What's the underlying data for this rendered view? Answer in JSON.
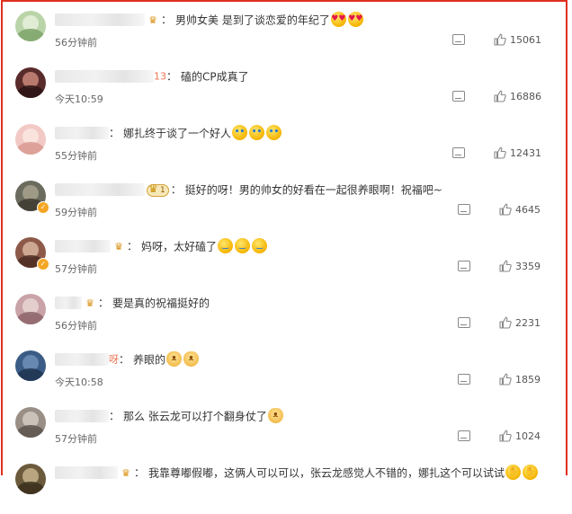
{
  "comments": [
    {
      "username_suffix": "",
      "badge": "crown",
      "text": "男帅女美 是到了谈恋爱的年纪了",
      "emojis": [
        {
          "name": "heart-eyes-emoji"
        },
        {
          "name": "heart-eyes-emoji"
        }
      ],
      "time": "56分钟前",
      "likes": "15061",
      "avatar_colors": [
        "#b9d4a8",
        "#e8f0dc",
        "#7da36a"
      ],
      "verified": false
    },
    {
      "username_suffix": "13",
      "badge": "",
      "text": "磕的CP成真了",
      "emojis": [],
      "time": "今天10:59",
      "likes": "16886",
      "avatar_colors": [
        "#5a2b2b",
        "#c9877a",
        "#2a1414"
      ],
      "verified": false
    },
    {
      "username_suffix": "",
      "badge": "",
      "text": "娜扎终于谈了一个好人",
      "emojis": [
        {
          "name": "crying-emoji"
        },
        {
          "name": "crying-emoji"
        },
        {
          "name": "crying-emoji"
        }
      ],
      "time": "55分钟前",
      "likes": "12431",
      "avatar_colors": [
        "#f2c9c4",
        "#fbe7e2",
        "#d99a92"
      ],
      "verified": false
    },
    {
      "username_suffix": "",
      "badge": "vip",
      "vip_text": "1",
      "text": "挺好的呀！男的帅女的好看在一起很养眼啊！祝福吧~",
      "emojis": [],
      "time": "59分钟前",
      "likes": "4645",
      "avatar_colors": [
        "#6b6b5e",
        "#a7a28c",
        "#3d3a30"
      ],
      "verified": true
    },
    {
      "username_suffix": "",
      "badge": "crown",
      "text": "妈呀，太好磕了",
      "emojis": [
        {
          "name": "laugh-cry-emoji"
        },
        {
          "name": "laugh-cry-emoji"
        },
        {
          "name": "laugh-cry-emoji"
        }
      ],
      "time": "57分钟前",
      "likes": "3359",
      "avatar_colors": [
        "#8d5a4a",
        "#d8b59c",
        "#4b2c22"
      ],
      "verified": true
    },
    {
      "username_suffix": "",
      "badge": "crown",
      "text": "要是真的祝福挺好的",
      "emojis": [],
      "time": "56分钟前",
      "likes": "2231",
      "avatar_colors": [
        "#c9a3a8",
        "#e9d6d2",
        "#8c6469"
      ],
      "verified": false
    },
    {
      "username_suffix": "呀",
      "badge": "",
      "text": "养眼的",
      "emojis": [
        {
          "name": "cat-face-emoji"
        },
        {
          "name": "cat-face-emoji"
        }
      ],
      "time": "今天10:58",
      "likes": "1859",
      "avatar_colors": [
        "#3b5c86",
        "#6f8fb8",
        "#1f3450"
      ],
      "verified": false
    },
    {
      "username_suffix": "",
      "badge": "",
      "text": "那么 张云龙可以打个翻身仗了",
      "emojis": [
        {
          "name": "cat-face-emoji"
        }
      ],
      "time": "57分钟前",
      "likes": "1024",
      "avatar_colors": [
        "#9a8f86",
        "#d4cbc3",
        "#5d544d"
      ],
      "verified": false
    },
    {
      "username_suffix": "",
      "badge": "crown",
      "text": "我靠尊嘟假嘟，这俩人可以可以，张云龙感觉人不错的，娜扎这个可以试试",
      "emojis": [
        {
          "name": "clapping-emoji"
        },
        {
          "name": "clapping-emoji"
        }
      ],
      "time": "",
      "likes": "",
      "avatar_colors": [
        "#6b5a3c",
        "#c7b48d",
        "#3a2f1c"
      ],
      "verified": false
    }
  ],
  "colors": {
    "frame_border": "#e0301e",
    "username_accent": "#eb7350",
    "time_text": "#666666",
    "body_text": "#333333"
  }
}
